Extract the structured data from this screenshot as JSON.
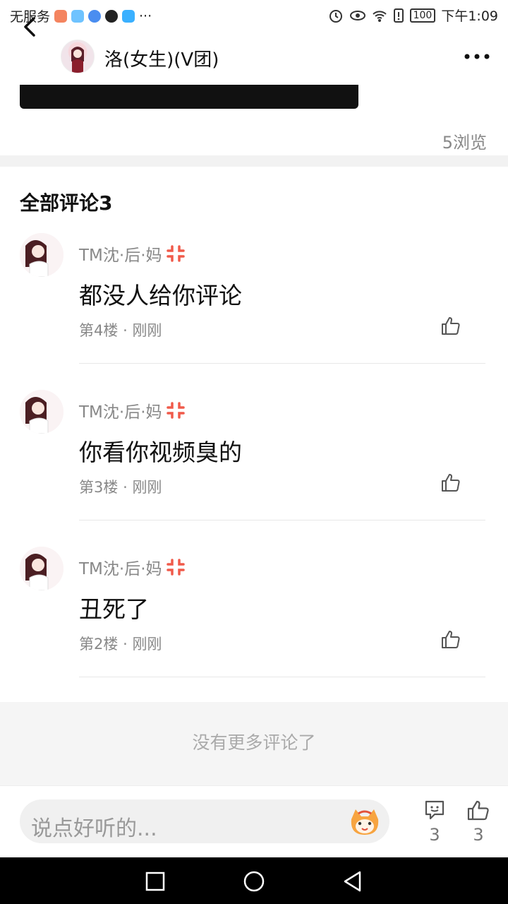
{
  "status_bar": {
    "carrier": "无服务",
    "battery": "100",
    "time": "下午1:09",
    "more": "···"
  },
  "header": {
    "title": "洛(女生)(V团)"
  },
  "post": {
    "views": "5浏览"
  },
  "comments_section": {
    "title": "全部评论3",
    "items": [
      {
        "author": "TM沈·后·妈",
        "text": "都没人给你评论",
        "floor": "第4楼",
        "time": "刚刚"
      },
      {
        "author": "TM沈·后·妈",
        "text": "你看你视频臭的",
        "floor": "第3楼",
        "time": "刚刚"
      },
      {
        "author": "TM沈·后·妈",
        "text": "丑死了",
        "floor": "第2楼",
        "time": "刚刚"
      }
    ],
    "meta_separator": "·",
    "no_more": "没有更多评论了"
  },
  "bottom_bar": {
    "input_placeholder": "说点好听的...",
    "comment_count": "3",
    "like_count": "3"
  },
  "colors": {
    "accent_anger": "#f05a4a",
    "text_secondary": "#888888"
  }
}
